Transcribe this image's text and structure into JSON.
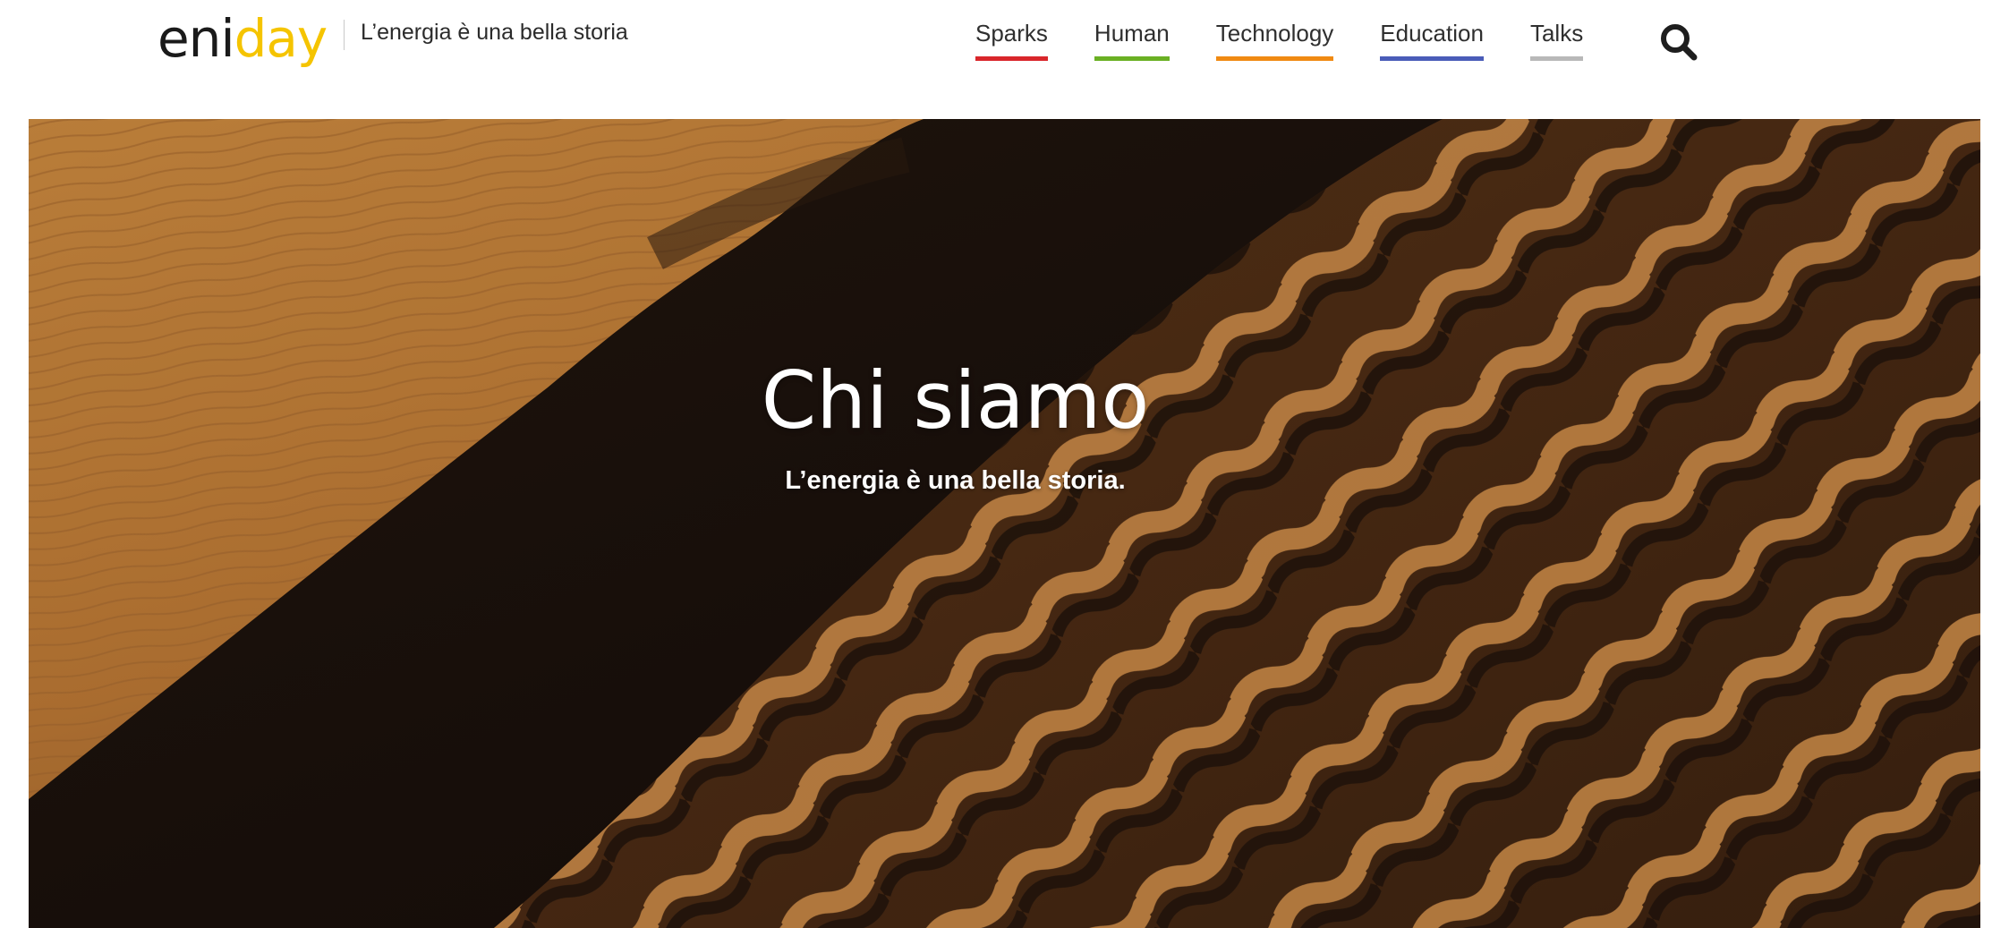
{
  "header": {
    "logo": {
      "prefix": "eni",
      "accent": "day"
    },
    "tagline": "L’energia è una bella storia",
    "nav": [
      {
        "label": "Sparks",
        "color": "#d9262b"
      },
      {
        "label": "Human",
        "color": "#6ab023"
      },
      {
        "label": "Technology",
        "color": "#f08a12"
      },
      {
        "label": "Education",
        "color": "#4a5cb8"
      },
      {
        "label": "Talks",
        "color": "#b8b8b8"
      }
    ],
    "search_icon": "search-icon"
  },
  "hero": {
    "title": "Chi siamo",
    "subtitle": "L’energia è una bella storia.",
    "image": "desert-sand-dunes"
  },
  "colors": {
    "brand_accent": "#f5c400",
    "text_dark": "#2f2f2f"
  }
}
